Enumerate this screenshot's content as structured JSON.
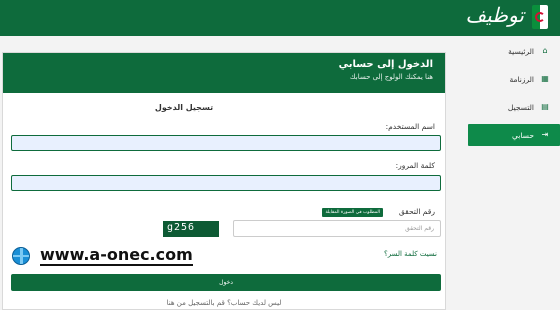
{
  "header": {
    "logo_text": "توظيف"
  },
  "sidebar": {
    "items": [
      {
        "label": "الرئيسية",
        "icon": "home-icon"
      },
      {
        "label": "الرزنامة",
        "icon": "calendar-icon"
      },
      {
        "label": "التسجيل",
        "icon": "register-icon"
      },
      {
        "label": "حسابي",
        "icon": "login-icon",
        "active": true
      }
    ]
  },
  "panel": {
    "title": "الدخول إلى حسابي",
    "subtitle": "هنا يمكنك الولوج إلى حسابك"
  },
  "form": {
    "title": "تسجيل الدخول",
    "username_label": "اسم المستخدم:",
    "username_value": "",
    "password_label": "كلمة المرور:",
    "password_value": "",
    "captcha_label": "رقم التحقق",
    "captcha_badge": "المطلوب في الصورة المقابلة",
    "captcha_placeholder": "رقم التحقق",
    "captcha_code": "g256",
    "forgot_link": "نسيت كلمة السر؟",
    "login_button": "دخول",
    "no_account_text": "ليس لديك حساب؟ قم بالتسجيل من هنا"
  },
  "watermark": {
    "text": "www.a-onec.com"
  },
  "colors": {
    "primary": "#0e6b3c",
    "active": "#0e8a4a",
    "field_bg": "#e8f0fe"
  }
}
